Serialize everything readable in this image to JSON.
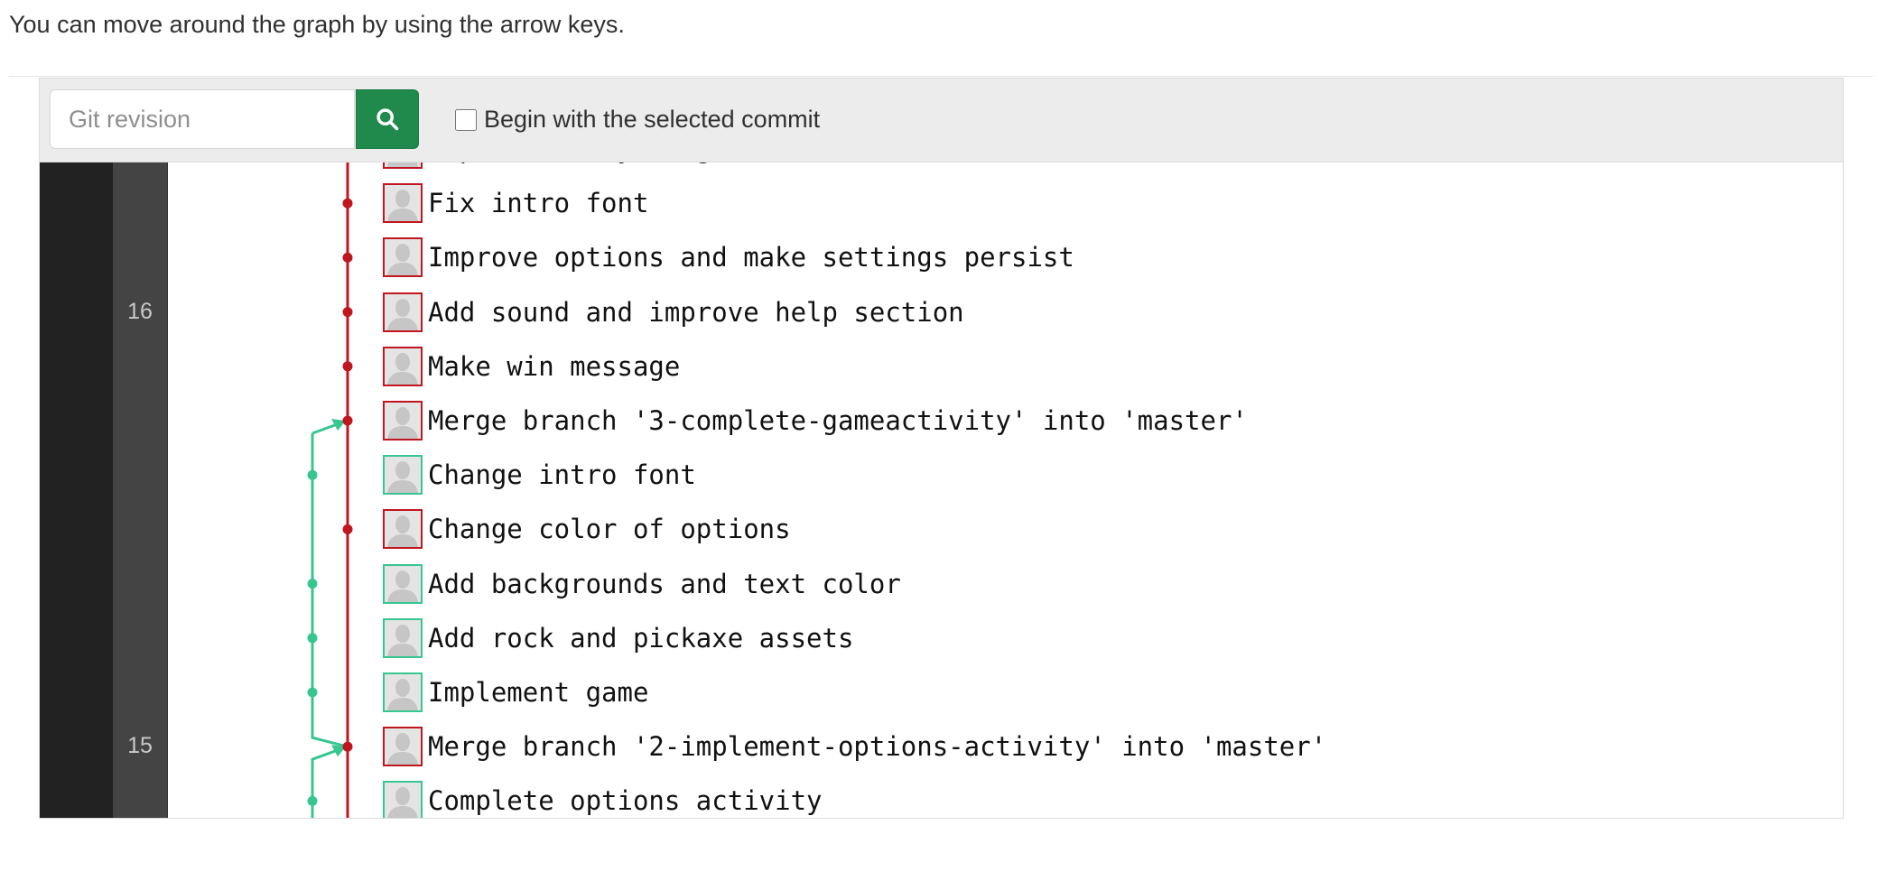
{
  "hint": "You can move around the graph by using the arrow keys.",
  "controls": {
    "revision_placeholder": "Git revision",
    "revision_value": "",
    "begin_label": "Begin with the selected commit",
    "begin_checked": false
  },
  "day_labels": [
    {
      "label": "16",
      "row": 3
    },
    {
      "label": "15",
      "row": 11
    }
  ],
  "colors": {
    "master": "#c0161f",
    "branch": "#37c690"
  },
  "commits": [
    {
      "message": "Improve story image",
      "branch": "master",
      "partial": true
    },
    {
      "message": "Fix intro font",
      "branch": "master"
    },
    {
      "message": "Improve options and make settings persist",
      "branch": "master"
    },
    {
      "message": "Add sound and improve help section",
      "branch": "master"
    },
    {
      "message": "Make win message",
      "branch": "master"
    },
    {
      "message": "Merge branch '3-complete-gameactivity' into 'master'",
      "branch": "master",
      "merge": true
    },
    {
      "message": "Change intro font",
      "branch": "feature"
    },
    {
      "message": "Change color of options",
      "branch": "master"
    },
    {
      "message": "Add backgrounds and text color",
      "branch": "feature"
    },
    {
      "message": "Add rock and pickaxe assets",
      "branch": "feature"
    },
    {
      "message": "Implement game",
      "branch": "feature"
    },
    {
      "message": "Merge branch '2-implement-options-activity' into 'master'",
      "branch": "master",
      "merge": true
    },
    {
      "message": "Complete options activity",
      "branch": "feature"
    }
  ]
}
